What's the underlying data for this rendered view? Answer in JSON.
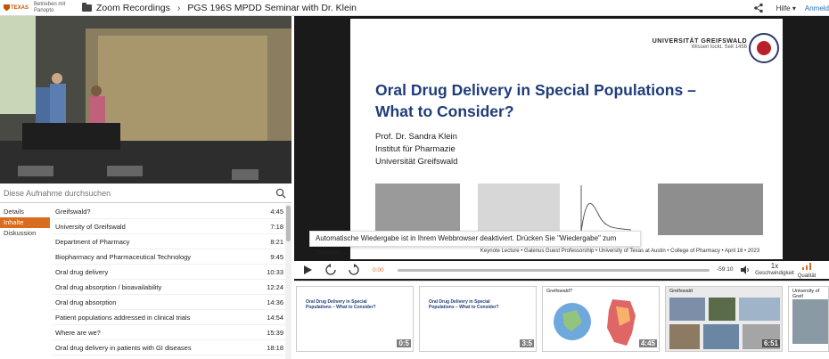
{
  "topbar": {
    "logo_text": "TEXAS",
    "powered_by": "Betrieben mit Panopto",
    "breadcrumb": [
      "Zoom Recordings",
      "PGS 196S MPDD Seminar with Dr. Klein"
    ],
    "help_label": "Hilfe",
    "login_label": "Anmeld"
  },
  "left": {
    "search_placeholder": "Diese Aufnahme durchsuchen",
    "tabs": [
      {
        "label": "Details",
        "active": false
      },
      {
        "label": "Inhalte",
        "active": true
      },
      {
        "label": "Diskussion",
        "active": false
      }
    ],
    "toc": [
      {
        "title": "Greifswald?",
        "time": "4:45"
      },
      {
        "title": "University of Greifswald",
        "time": "7:18"
      },
      {
        "title": "Department of Pharmacy",
        "time": "8:21"
      },
      {
        "title": "Biopharmacy and Pharmaceutical Technology",
        "time": "9:45"
      },
      {
        "title": "Oral drug delivery",
        "time": "10:33"
      },
      {
        "title": "Oral drug absorption / bioavailability",
        "time": "12:24"
      },
      {
        "title": "Oral drug absorption",
        "time": "14:36"
      },
      {
        "title": "Patient populations addressed in clinical trials",
        "time": "14:54"
      },
      {
        "title": "Where are we?",
        "time": "15:39"
      },
      {
        "title": "Oral drug delivery in patients with GI diseases",
        "time": "18:18"
      }
    ]
  },
  "slide": {
    "university": "UNIVERSITÄT GREIFSWALD",
    "slogan": "Wissen lockt. Seit 1456",
    "title_line1": "Oral Drug Delivery in Special Populations –",
    "title_line2": "What to Consider?",
    "author_lines": [
      "Prof. Dr. Sandra Klein",
      "Institut für Pharmazie",
      "Universität Greifswald"
    ],
    "footer": "Keynote Lecture  •  Galenus Guest Professorship  •  University of Texas at Austin  •  College of Pharmacy  •  April 18  •  2023"
  },
  "tooltip": "Automatische Wiedergabe ist in Ihrem Webbrowser deaktiviert. Drücken Sie \"Wiedergabe\" zum Starten.",
  "controls": {
    "current_time": "0:00",
    "remaining_time": "-59:10",
    "speed_value": "1x",
    "speed_label": "Geschwindigkeit",
    "quality_label": "Qualität"
  },
  "thumbnails": [
    {
      "header": "",
      "title": "Oral Drug Delivery in Special Populations – What to Consider?",
      "time": "0:5"
    },
    {
      "header": "",
      "title": "Oral Drug Delivery in Special Populations – What to Consider?",
      "time": "3:5"
    },
    {
      "header": "Greifswald?",
      "title": "",
      "time": "4:45"
    },
    {
      "header": "Greifswald",
      "title": "",
      "time": "6:51"
    },
    {
      "header": "University of Greif",
      "title": "",
      "time": ""
    }
  ]
}
